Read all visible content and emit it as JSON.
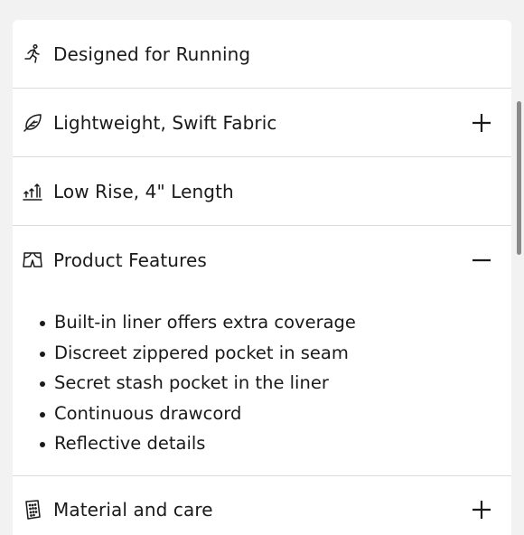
{
  "accordion": {
    "items": [
      {
        "label": "Designed for Running",
        "icon": "running-person-icon",
        "expandable": false
      },
      {
        "label": "Lightweight, Swift Fabric",
        "icon": "leaf-feather-icon",
        "expandable": true,
        "toggle": "plus-icon"
      },
      {
        "label": "Low Rise, 4\" Length",
        "icon": "length-arrows-icon",
        "expandable": false
      },
      {
        "label": "Product Features",
        "icon": "shorts-icon",
        "expandable": true,
        "expanded": true,
        "toggle": "minus-icon"
      },
      {
        "label": "Material and care",
        "icon": "care-label-icon",
        "expandable": true,
        "toggle": "plus-icon"
      }
    ],
    "features": [
      "Built-in liner offers extra coverage",
      "Discreet zippered pocket in seam",
      "Secret stash pocket in the liner",
      "Continuous drawcord",
      "Reflective details"
    ]
  },
  "colors": {
    "text": "#1a1a1a",
    "divider": "#dcdcdc",
    "background": "#ffffff",
    "scrollbar": "#8a8a8a"
  }
}
